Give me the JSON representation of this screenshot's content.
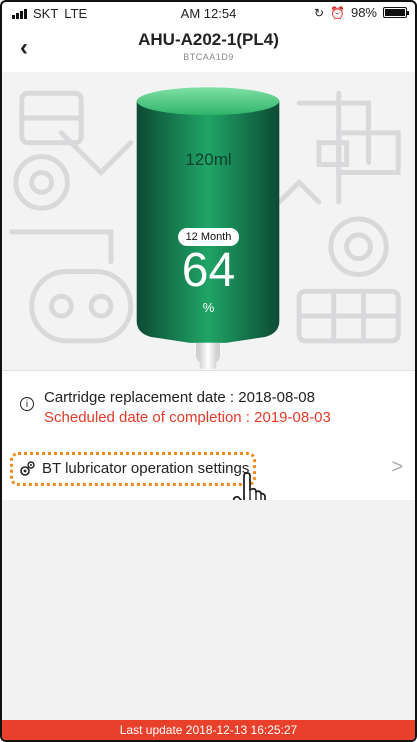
{
  "status_bar": {
    "carrier": "SKT",
    "network": "LTE",
    "time": "AM 12:54",
    "battery": "98%",
    "battery_level": 0.98
  },
  "header": {
    "back_icon": "chevron-left-icon",
    "title": "AHU-A202-1(PL4)",
    "subtitle": "BTCAA1D9"
  },
  "cartridge": {
    "capacity": "120ml",
    "months": "12 Month",
    "percent_value": "64",
    "percent_unit": "%",
    "fill_color": "#1a9a5c",
    "dark_color": "#0d4a35"
  },
  "info": {
    "icon": "info-icon",
    "replacement": "Cartridge replacement date : 2018-08-08",
    "completion": "Scheduled date of completion : 2019-08-03",
    "completion_color": "#e53a2a"
  },
  "settings": {
    "icon": "gear-icon",
    "label": "BT lubricator operation settings",
    "chevron": ">"
  },
  "footer": {
    "text": "Last update 2018-12-13 16:25:27",
    "color": "#e8402a"
  }
}
